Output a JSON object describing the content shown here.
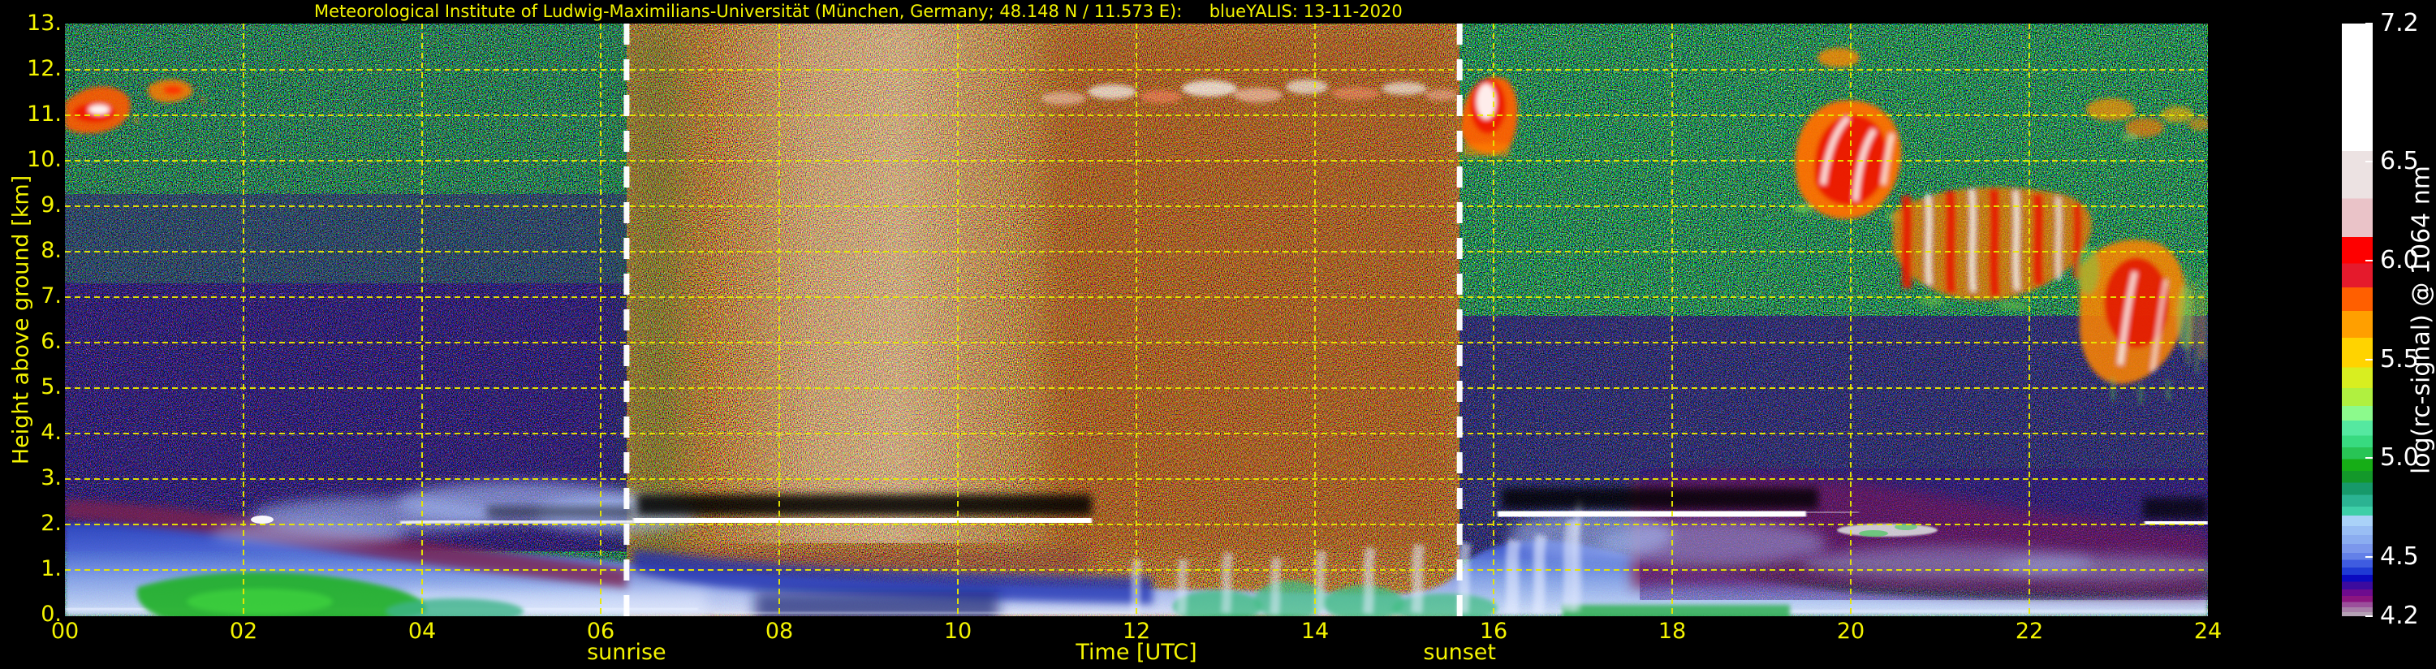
{
  "chart_data": {
    "type": "heatmap",
    "title": "Meteorological Institute of Ludwig-Maximilians-Universität (München, Germany; 48.148 N / 11.573 E):     blueYALIS: 13-11-2020",
    "station": "Meteorological Institute of Ludwig-Maximilians-Universität",
    "location": "München, Germany",
    "coordinates": "48.148 N / 11.573 E",
    "instrument": "blueYALIS",
    "date": "13-11-2020",
    "axes": {
      "x": {
        "label": "Time [UTC]",
        "tick_labels": [
          "00",
          "02",
          "04",
          "06",
          "08",
          "10",
          "12",
          "14",
          "16",
          "18",
          "20",
          "22",
          "24"
        ],
        "tick_values": [
          0,
          2,
          4,
          6,
          8,
          10,
          12,
          14,
          16,
          18,
          20,
          22,
          24
        ],
        "range_hours": [
          0,
          24
        ],
        "gridlines_every_hours": 2
      },
      "y": {
        "label": "Height above ground [km]",
        "tick_labels": [
          "0.",
          "1.",
          "2.",
          "3.",
          "4.",
          "5.",
          "6.",
          "7.",
          "8.",
          "9.",
          "10.",
          "11.",
          "12.",
          "13."
        ],
        "tick_values": [
          0,
          1,
          2,
          3,
          4,
          5,
          6,
          7,
          8,
          9,
          10,
          11,
          12,
          13
        ],
        "range_km": [
          0,
          13
        ],
        "gridlines_every_km": 1
      }
    },
    "colorbar": {
      "label": "log(rc-signal) @ 1064 nm",
      "tick_labels": [
        "7.2",
        "6.5",
        "6.0",
        "5.5",
        "5.0",
        "4.5",
        "4.2"
      ],
      "tick_values": [
        7.2,
        6.5,
        6.0,
        5.5,
        5.0,
        4.5,
        4.2
      ],
      "range": [
        4.2,
        7.2
      ],
      "stops": [
        [
          0.215,
          "#ffffff"
        ],
        [
          0.295,
          "#ece2e2"
        ],
        [
          0.36,
          "#eac3c8"
        ],
        [
          0.405,
          "#fe0000"
        ],
        [
          0.445,
          "#e51a2c"
        ],
        [
          0.485,
          "#ff5f00"
        ],
        [
          0.53,
          "#ff9f00"
        ],
        [
          0.58,
          "#ffd300"
        ],
        [
          0.615,
          "#d8ee20"
        ],
        [
          0.645,
          "#b0f040"
        ],
        [
          0.67,
          "#8cfa8c"
        ],
        [
          0.695,
          "#55e8a0"
        ],
        [
          0.715,
          "#38da80"
        ],
        [
          0.735,
          "#28c455"
        ],
        [
          0.755,
          "#16ad16"
        ],
        [
          0.775,
          "#13982a"
        ],
        [
          0.795,
          "#17996a"
        ],
        [
          0.815,
          "#2bb392"
        ],
        [
          0.83,
          "#3ecfa8"
        ],
        [
          0.848,
          "#aad2f8"
        ],
        [
          0.863,
          "#99bef4"
        ],
        [
          0.878,
          "#8badf0"
        ],
        [
          0.893,
          "#7b97ec"
        ],
        [
          0.905,
          "#6380e8"
        ],
        [
          0.918,
          "#3f5ce0"
        ],
        [
          0.93,
          "#1f3ad4"
        ],
        [
          0.942,
          "#0a0ac0"
        ],
        [
          0.955,
          "#3c0b9e"
        ],
        [
          0.966,
          "#6e0b8e"
        ],
        [
          0.976,
          "#8c1580"
        ],
        [
          0.985,
          "#9b4f9b"
        ],
        [
          0.993,
          "#a87fa8"
        ],
        [
          1.0,
          "#b5a2b5"
        ]
      ]
    },
    "annotations": [
      {
        "label": "sunrise",
        "time_utc": 6.29
      },
      {
        "label": "sunset",
        "time_utc": 15.62
      }
    ],
    "features": [
      "night-time background: green/blue multicolour speckle noise (00:00-06:17 and 15:37-24:00)",
      "daylight background noise 06:17-15:37: dense brown/white/black speckle, brightest whitish column ~08:30-10:30, reddish-brown 11:00-15:30",
      "green near-surface aerosol layer below ~1 km from 00:00-04:30, again 12:00-19:00 near ground",
      "light-blue boundary-layer aerosol below ~1.5 km throughout the day",
      "maroon residual aerosol band 1-2.3 km at night, very pronounced 18:00-24:00",
      "thin liquid water cloud line at ~2.0-2.1 km from ~03:45-11:30 (white, strong attenuation above), again ~2.2 km 16:00-18:30 and ~23:30-24:00",
      "cirrus at 11-12 km around 00:00-01:30 (orange/red), thin whitish cirrus 11.5 km 11:30-15:30",
      "bright orange/red cirrus blob 10.5-12 km right at sunset ~15:40-16:15",
      "thick cirrus with fallstreaks descending from ~11.5 km at 19:30 to ~5.5-6 km by 24:00 (orange/red with white cores, green fringes)"
    ],
    "colors": {
      "axis_text": "#f4f400",
      "gridlines": "#e8e800",
      "colorbar_text": "#ffffff",
      "sun_lines": "#ffffff",
      "background": "#000000"
    }
  }
}
